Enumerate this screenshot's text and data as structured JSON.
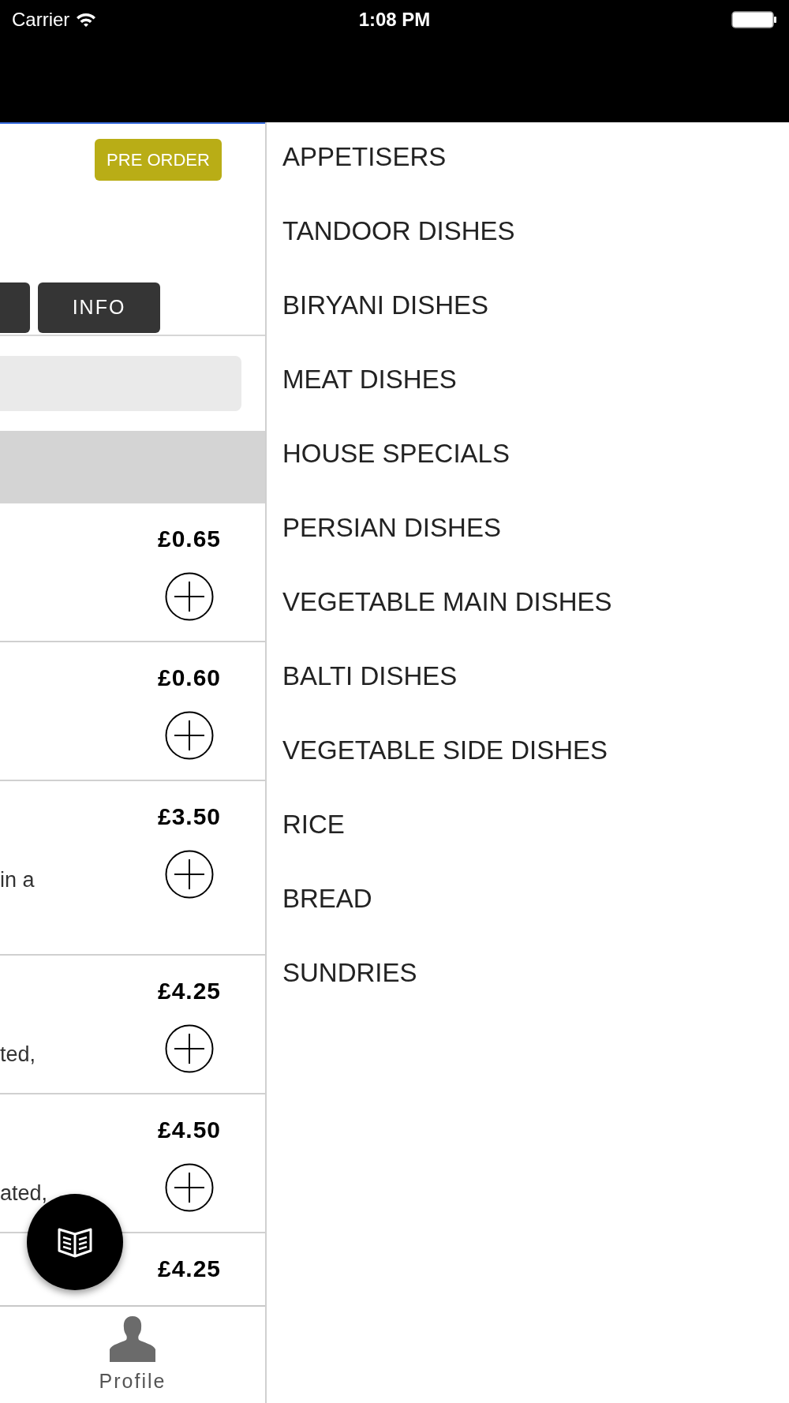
{
  "status_bar": {
    "carrier": "Carrier",
    "time": "1:08 PM"
  },
  "header": {
    "pre_order_button": "PRE ORDER"
  },
  "tabs": [
    {
      "kind": "cut"
    },
    {
      "kind": "full",
      "label": "INFO"
    }
  ],
  "menu_items": [
    {
      "price": "£0.65"
    },
    {
      "price": "£0.60"
    },
    {
      "price": "£3.50",
      "description": "in a"
    },
    {
      "price": "£4.25",
      "description": "ted,"
    },
    {
      "price": "£4.50",
      "description": "ated,"
    },
    {
      "price": "£4.25"
    }
  ],
  "bottom_tab": {
    "label": "Profile"
  },
  "categories": [
    "APPETISERS",
    "TANDOOR DISHES",
    "BIRYANI DISHES",
    "MEAT DISHES",
    "HOUSE SPECIALS",
    "PERSIAN DISHES",
    "VEGETABLE MAIN DISHES",
    "BALTI DISHES",
    "VEGETABLE SIDE DISHES",
    "RICE",
    "BREAD",
    "SUNDRIES"
  ]
}
